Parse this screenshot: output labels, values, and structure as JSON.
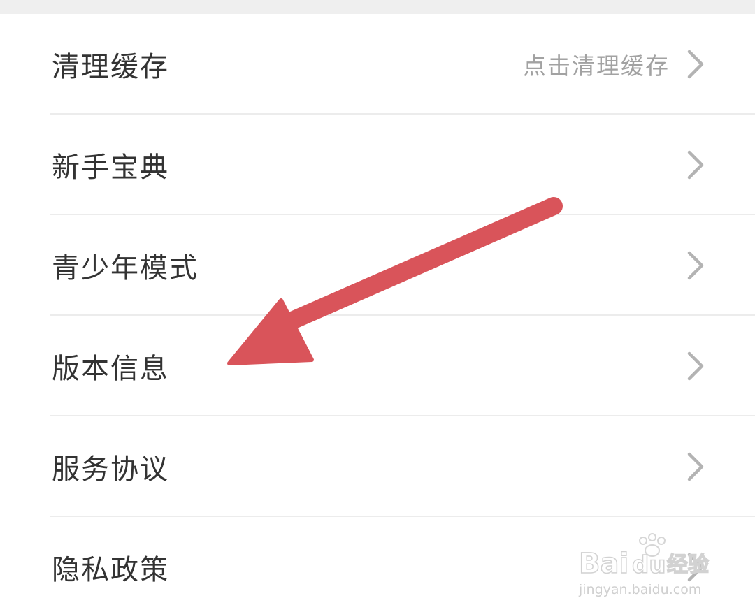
{
  "settings": {
    "items": [
      {
        "label": "清理缓存",
        "hint": "点击清理缓存",
        "icon": "chevron-right-icon"
      },
      {
        "label": "新手宝典",
        "hint": "",
        "icon": "chevron-right-icon"
      },
      {
        "label": "青少年模式",
        "hint": "",
        "icon": "chevron-right-icon"
      },
      {
        "label": "版本信息",
        "hint": "",
        "icon": "chevron-right-icon"
      },
      {
        "label": "服务协议",
        "hint": "",
        "icon": "chevron-right-icon"
      },
      {
        "label": "隐私政策",
        "hint": "",
        "icon": "chevron-right-icon"
      }
    ]
  },
  "annotation": {
    "icon": "red-arrow-icon",
    "color": "#d9545a"
  },
  "watermark": {
    "brand": "Bai du 经验",
    "url": "jingyan.baidu.com"
  },
  "colors": {
    "label": "#333333",
    "hint": "#a2a2a2",
    "chevron": "#b3b3b3",
    "divider": "#ececec",
    "top_strip": "#efefef"
  }
}
